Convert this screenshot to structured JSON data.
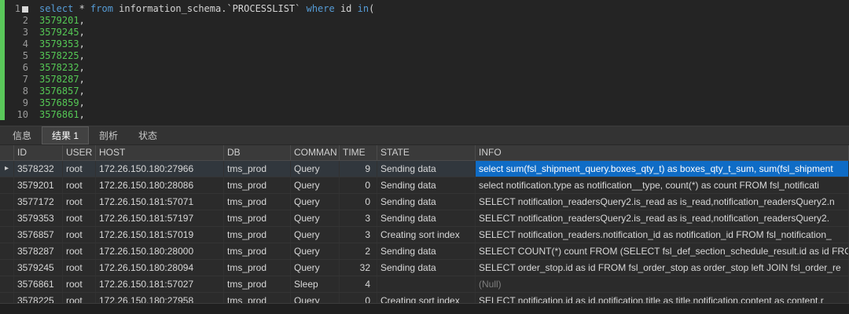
{
  "editor": {
    "lines": [
      {
        "num": "1",
        "marker": true,
        "tokens": [
          {
            "t": "kw",
            "s": "select"
          },
          {
            "t": "plain",
            "s": " * "
          },
          {
            "t": "kw",
            "s": "from"
          },
          {
            "t": "plain",
            "s": " information_schema.`PROCESSLIST` "
          },
          {
            "t": "kw",
            "s": "where"
          },
          {
            "t": "plain",
            "s": " id "
          },
          {
            "t": "kw",
            "s": "in"
          },
          {
            "t": "plain",
            "s": "("
          }
        ]
      },
      {
        "num": "2",
        "tokens": [
          {
            "t": "num",
            "s": "3579201"
          },
          {
            "t": "plain",
            "s": ","
          }
        ]
      },
      {
        "num": "3",
        "tokens": [
          {
            "t": "num",
            "s": "3579245"
          },
          {
            "t": "plain",
            "s": ","
          }
        ]
      },
      {
        "num": "4",
        "tokens": [
          {
            "t": "num",
            "s": "3579353"
          },
          {
            "t": "plain",
            "s": ","
          }
        ]
      },
      {
        "num": "5",
        "tokens": [
          {
            "t": "num",
            "s": "3578225"
          },
          {
            "t": "plain",
            "s": ","
          }
        ]
      },
      {
        "num": "6",
        "tokens": [
          {
            "t": "num",
            "s": "3578232"
          },
          {
            "t": "plain",
            "s": ","
          }
        ]
      },
      {
        "num": "7",
        "tokens": [
          {
            "t": "num",
            "s": "3578287"
          },
          {
            "t": "plain",
            "s": ","
          }
        ]
      },
      {
        "num": "8",
        "tokens": [
          {
            "t": "num",
            "s": "3576857"
          },
          {
            "t": "plain",
            "s": ","
          }
        ]
      },
      {
        "num": "9",
        "tokens": [
          {
            "t": "num",
            "s": "3576859"
          },
          {
            "t": "plain",
            "s": ","
          }
        ]
      },
      {
        "num": "10",
        "tokens": [
          {
            "t": "num",
            "s": "3576861"
          },
          {
            "t": "plain",
            "s": ","
          }
        ]
      }
    ]
  },
  "tabs": [
    {
      "label": "信息",
      "active": false
    },
    {
      "label": "结果 1",
      "active": true
    },
    {
      "label": "剖析",
      "active": false
    },
    {
      "label": "状态",
      "active": false
    }
  ],
  "grid": {
    "columns": [
      "",
      "ID",
      "USER",
      "HOST",
      "DB",
      "COMMAN",
      "TIME",
      "STATE",
      "INFO"
    ],
    "rows": [
      {
        "id": "3578232",
        "user": "root",
        "host": "172.26.150.180:27966",
        "db": "tms_prod",
        "command": "Query",
        "time": "9",
        "state": "Sending data",
        "info": "select sum(fsl_shipment_query.boxes_qty_t) as boxes_qty_t_sum, sum(fsl_shipment",
        "selected": true,
        "null_info": false
      },
      {
        "id": "3579201",
        "user": "root",
        "host": "172.26.150.180:28086",
        "db": "tms_prod",
        "command": "Query",
        "time": "0",
        "state": "Sending data",
        "info": "select notification.type as notification__type, count(*) as  count  FROM fsl_notificati",
        "selected": false,
        "null_info": false
      },
      {
        "id": "3577172",
        "user": "root",
        "host": "172.26.150.181:57071",
        "db": "tms_prod",
        "command": "Query",
        "time": "0",
        "state": "Sending data",
        "info": "SELECT notification_readersQuery2.is_read as is_read,notification_readersQuery2.n",
        "selected": false,
        "null_info": false
      },
      {
        "id": "3579353",
        "user": "root",
        "host": "172.26.150.181:57197",
        "db": "tms_prod",
        "command": "Query",
        "time": "3",
        "state": "Sending data",
        "info": "SELECT notification_readersQuery2.is_read as is_read,notification_readersQuery2.",
        "selected": false,
        "null_info": false
      },
      {
        "id": "3576857",
        "user": "root",
        "host": "172.26.150.181:57019",
        "db": "tms_prod",
        "command": "Query",
        "time": "3",
        "state": "Creating sort index",
        "info": "SELECT notification_readers.notification_id as notification_id FROM fsl_notification_",
        "selected": false,
        "null_info": false
      },
      {
        "id": "3578287",
        "user": "root",
        "host": "172.26.150.180:28000",
        "db": "tms_prod",
        "command": "Query",
        "time": "2",
        "state": "Sending data",
        "info": "SELECT COUNT(*) count FROM (SELECT fsl_def_section_schedule_result.id as id FRC",
        "selected": false,
        "null_info": false
      },
      {
        "id": "3579245",
        "user": "root",
        "host": "172.26.150.180:28094",
        "db": "tms_prod",
        "command": "Query",
        "time": "32",
        "state": "Sending data",
        "info": "SELECT order_stop.id as id FROM fsl_order_stop as order_stop left JOIN fsl_order_re",
        "selected": false,
        "null_info": false
      },
      {
        "id": "3576861",
        "user": "root",
        "host": "172.26.150.181:57027",
        "db": "tms_prod",
        "command": "Sleep",
        "time": "4",
        "state": "",
        "info": "(Null)",
        "selected": false,
        "null_info": true
      },
      {
        "id": "3578225",
        "user": "root",
        "host": "172.26.150.180:27958",
        "db": "tms_prod",
        "command": "Query",
        "time": "0",
        "state": "Creating sort index",
        "info": "SELECT notification.id as id,notification.title as title,notification.content as content,r",
        "selected": false,
        "null_info": false
      }
    ]
  },
  "icons": {
    "row_marker": "▸",
    "statement_marker": "stmt-square-icon"
  }
}
